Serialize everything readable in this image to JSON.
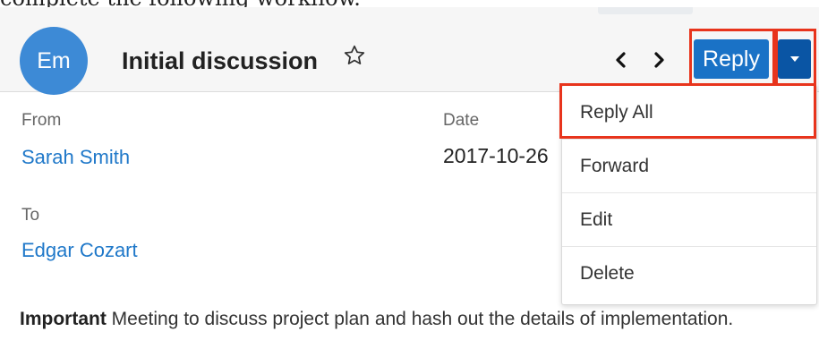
{
  "top_text": "complete the following workflow.",
  "header": {
    "avatar_initials": "Em",
    "title": "Initial discussion",
    "star_icon": "star-outline-icon",
    "prev_icon": "chevron-left-icon",
    "next_icon": "chevron-right-icon",
    "reply_label": "Reply",
    "caret_icon": "caret-down-icon"
  },
  "fields": {
    "from_label": "From",
    "from_value": "Sarah Smith",
    "date_label": "Date",
    "date_value": "2017-10-26",
    "to_label": "To",
    "to_value": "Edgar Cozart"
  },
  "menu": {
    "items": [
      "Reply All",
      "Forward",
      "Edit",
      "Delete"
    ]
  },
  "body": {
    "emphasis": "Important",
    "text": " Meeting to discuss project plan and hash out the details of implementation."
  },
  "colors": {
    "primary": "#1a72c6",
    "primary_dark": "#0a55a4",
    "link": "#1f78c9",
    "highlight": "#e8341c",
    "avatar": "#3d8ad6"
  }
}
